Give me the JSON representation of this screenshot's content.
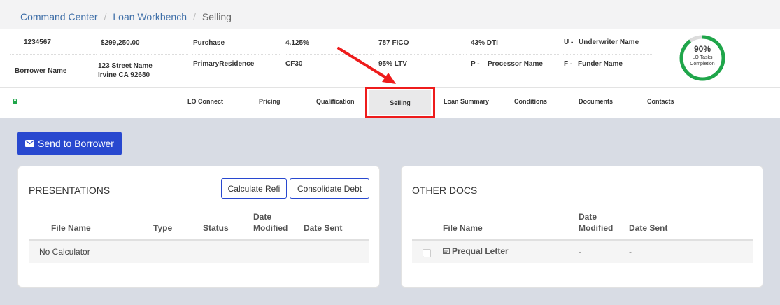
{
  "breadcrumb": {
    "items": [
      "Command Center",
      "Loan Workbench"
    ],
    "current": "Selling"
  },
  "loan": {
    "loan_number": "1234567",
    "borrower_label": "Borrower Name",
    "amount": "$299,250.00",
    "address_line1": "123 Street Name",
    "address_line2": "Irvine CA 92680",
    "purpose": "Purchase",
    "occupancy": "PrimaryResidence",
    "rate": "4.125%",
    "product": "CF30",
    "fico": "787 FICO",
    "ltv": "95% LTV",
    "dti": "43% DTI",
    "processor_prefix": "P -",
    "processor": "Processor Name",
    "underwriter_prefix": "U -",
    "underwriter": "Underwriter Name",
    "funder_prefix": "F -",
    "funder": "Funder Name",
    "tasks_percent": "90%",
    "tasks_label_1": "LO Tasks",
    "tasks_label_2": "Completion",
    "tasks_progress": 0.9
  },
  "tabs": [
    "LO Connect",
    "Pricing",
    "Qualification",
    "Selling",
    "Loan Summary",
    "Conditions",
    "Documents",
    "Contacts"
  ],
  "active_tab": "Selling",
  "send_button": "Send to Borrower",
  "presentations": {
    "title": "PRESENTATIONS",
    "calc_refi": "Calculate Refi",
    "consolidate": "Consolidate Debt",
    "col_file": "File Name",
    "col_type": "Type",
    "col_status": "Status",
    "col_date_1": "Date",
    "col_date_2": "Modified",
    "col_sent": "Date Sent",
    "empty_row": "No Calculator"
  },
  "other_docs": {
    "title": "OTHER DOCS",
    "col_file": "File Name",
    "col_date_1": "Date",
    "col_date_2": "Modified",
    "col_sent": "Date Sent",
    "rows": [
      {
        "name": "Prequal Letter",
        "modified": "-",
        "sent": "-"
      }
    ]
  },
  "colors": {
    "accent": "#2848cf",
    "link": "#3f6fa8",
    "progress": "#1fa64a",
    "annotation": "#ee1c1c"
  },
  "icons": [
    "envelope-icon",
    "lock-icon",
    "document-icon"
  ]
}
